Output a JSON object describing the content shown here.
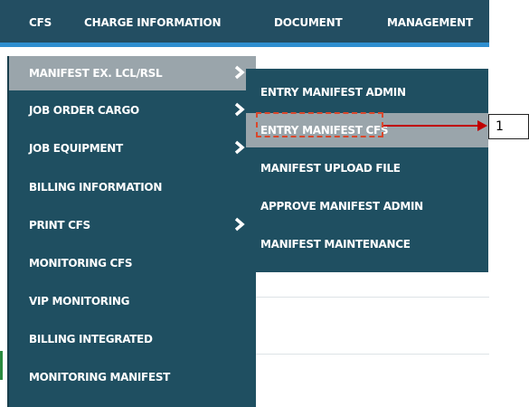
{
  "topnav": {
    "items": [
      "CFS",
      "CHARGE INFORMATION",
      "DOCUMENT",
      "MANAGEMENT"
    ]
  },
  "menu": {
    "items": [
      {
        "label": "MANIFEST EX. LCL/RSL",
        "has_submenu": true,
        "active": true
      },
      {
        "label": "JOB ORDER CARGO",
        "has_submenu": true
      },
      {
        "label": "JOB EQUIPMENT",
        "has_submenu": true
      },
      {
        "label": "BILLING INFORMATION",
        "has_submenu": false
      },
      {
        "label": "PRINT CFS",
        "has_submenu": true
      },
      {
        "label": "MONITORING CFS",
        "has_submenu": false
      },
      {
        "label": "VIP MONITORING",
        "has_submenu": false
      },
      {
        "label": "BILLING INTEGRATED",
        "has_submenu": false
      },
      {
        "label": "MONITORING MANIFEST",
        "has_submenu": false
      }
    ],
    "arrow_icon": "chevron-right-icon"
  },
  "submenu": {
    "items": [
      {
        "label": "ENTRY MANIFEST ADMIN"
      },
      {
        "label": "ENTRY MANIFEST CFS",
        "highlighted": true
      },
      {
        "label": "MANIFEST UPLOAD FILE"
      },
      {
        "label": "APPROVE MANIFEST ADMIN"
      },
      {
        "label": "MANIFEST MAINTENANCE"
      }
    ]
  },
  "annotation": {
    "label": "1",
    "color": "#c00000"
  },
  "colors": {
    "menu_bg": "#1f4f61",
    "active_bg": "#9aa5ab",
    "accent_bar": "#2f8fd0"
  }
}
